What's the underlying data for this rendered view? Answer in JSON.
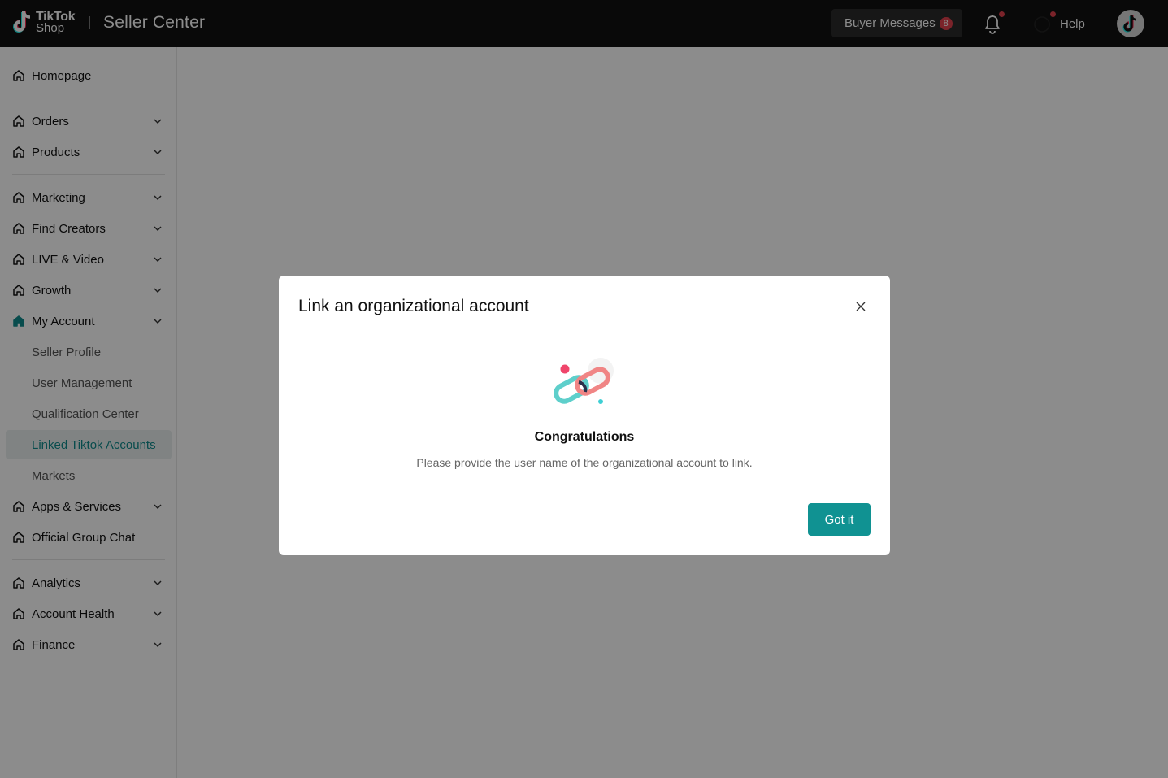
{
  "header": {
    "logo_line1": "TikTok",
    "logo_line2": "Shop",
    "title": "Seller Center",
    "buyer_messages_label": "Buyer Messages",
    "buyer_messages_count": "8",
    "help_label": "Help",
    "icons": [
      "tiktok-logo-icon",
      "bell-icon",
      "help-icon",
      "avatar"
    ]
  },
  "sidebar": {
    "items": [
      {
        "label": "Homepage",
        "chevron": false
      },
      {
        "label": "Orders",
        "chevron": true
      },
      {
        "label": "Products",
        "chevron": true
      },
      {
        "label": "Marketing",
        "chevron": true
      },
      {
        "label": "Find Creators",
        "chevron": true
      },
      {
        "label": "LIVE & Video",
        "chevron": true
      },
      {
        "label": "Growth",
        "chevron": true
      },
      {
        "label": "My Account",
        "chevron": true,
        "expanded": true
      },
      {
        "label": "Seller Profile",
        "sub": true
      },
      {
        "label": "User Management",
        "sub": true
      },
      {
        "label": "Qualification Center",
        "sub": true
      },
      {
        "label": "Linked Tiktok Accounts",
        "sub": true,
        "active": true
      },
      {
        "label": "Markets",
        "sub": true
      },
      {
        "label": "Apps & Services",
        "chevron": true
      },
      {
        "label": "Official Group Chat",
        "chevron": false
      },
      {
        "label": "Analytics",
        "chevron": true
      },
      {
        "label": "Account Health",
        "chevron": true
      },
      {
        "label": "Finance",
        "chevron": true
      }
    ]
  },
  "modal": {
    "title": "Link an organizational account",
    "heading": "Congratulations",
    "description": "Please provide the user name of the organizational account to link.",
    "button_label": "Got it"
  },
  "colors": {
    "accent": "#109292",
    "topbar": "#111111",
    "badge": "#e0414d",
    "active_text": "#0f8a8c"
  }
}
